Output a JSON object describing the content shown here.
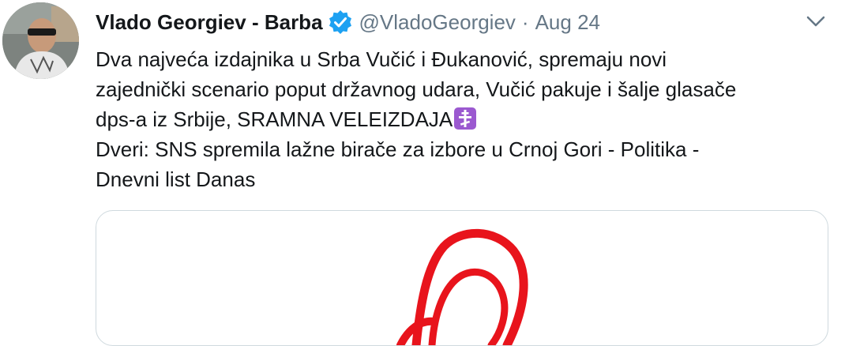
{
  "tweet": {
    "author_name": "Vlado Georgiev - Barba",
    "handle": "@VladoGeorgiev",
    "separator": "·",
    "date": "Aug 24",
    "lines": [
      "Dva najveća izdajnika u Srba Vučić i Đukanović, spremaju novi",
      "zajednički scenario poput državnog udara, Vučić pakuje i šalje glasače",
      "dps-a iz Srbije, SRAMNA VELEIZDAJA",
      "Dveri: SNS spremila lažne birače za izbore u Crnoj Gori - Politika -",
      "Dnevni list Danas"
    ],
    "emoji": "orthodox-cross-emoji"
  },
  "colors": {
    "verified_badge": "#1da1f2",
    "secondary_text": "#657786",
    "card_border": "#cfd9de",
    "logo_red": "#e8141c",
    "emoji_bg": "#9b59d0"
  },
  "icons": {
    "verified": "verified-badge-icon",
    "caret": "chevron-down-icon",
    "card_logo": "red-swirl-logo"
  }
}
